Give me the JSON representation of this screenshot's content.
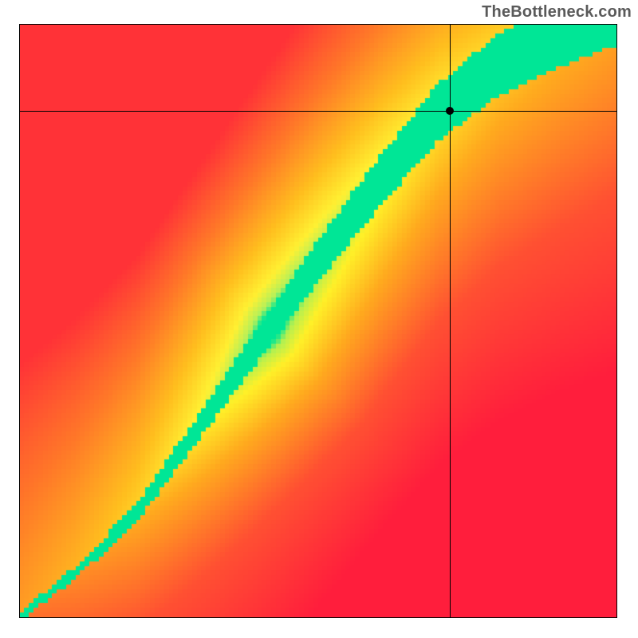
{
  "attribution": "TheBottleneck.com",
  "chart_data": {
    "type": "heatmap",
    "title": "",
    "xlabel": "",
    "ylabel": "",
    "xlim": [
      0,
      1
    ],
    "ylim": [
      0,
      1
    ],
    "colormap": "red-yellow-green-yellow-orange",
    "description": "2D heatmap where a green optimal band runs diagonally (slightly steeper than 45°). Value represents closeness to the optimal curve.",
    "crosshair": {
      "x": 0.72,
      "y": 0.855
    },
    "marker": {
      "x": 0.72,
      "y": 0.855
    },
    "curve_control_points": [
      [
        0.0,
        0.0
      ],
      [
        0.1,
        0.08
      ],
      [
        0.2,
        0.18
      ],
      [
        0.3,
        0.32
      ],
      [
        0.4,
        0.46
      ],
      [
        0.5,
        0.6
      ],
      [
        0.6,
        0.73
      ],
      [
        0.7,
        0.85
      ],
      [
        0.8,
        0.93
      ],
      [
        0.9,
        0.98
      ],
      [
        1.0,
        1.02
      ]
    ],
    "band_half_width_top": 0.055,
    "band_half_width_bottom": 0.006,
    "pixelation": 128
  }
}
